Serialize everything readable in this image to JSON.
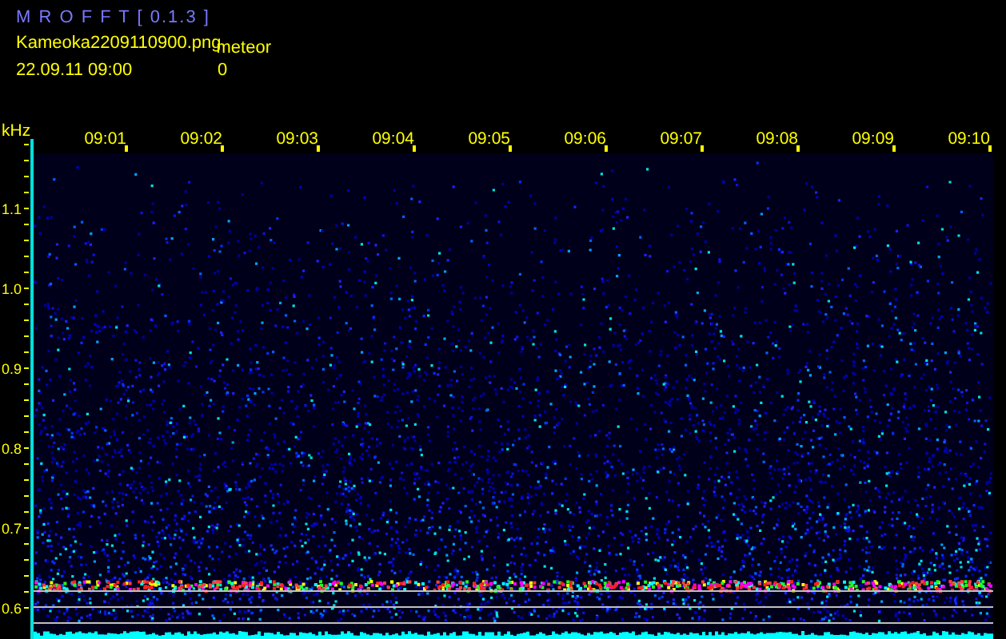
{
  "app_title": "M R O F F T [ 0.1.3 ]",
  "file_name": "Kameoka2209110900.png",
  "detection_label": "meteor",
  "timestamp": "22.09.11 09:00",
  "count": "0",
  "spectrogram": {
    "unit": "kHz",
    "time_labels": [
      "09:01",
      "09:02",
      "09:03",
      "09:04",
      "09:05",
      "09:06",
      "09:07",
      "09:08",
      "09:09",
      "09:10"
    ],
    "frequency_labels": [
      "1.1",
      "1.0",
      "0.9",
      "0.8",
      "0.7",
      "0.6"
    ]
  }
}
